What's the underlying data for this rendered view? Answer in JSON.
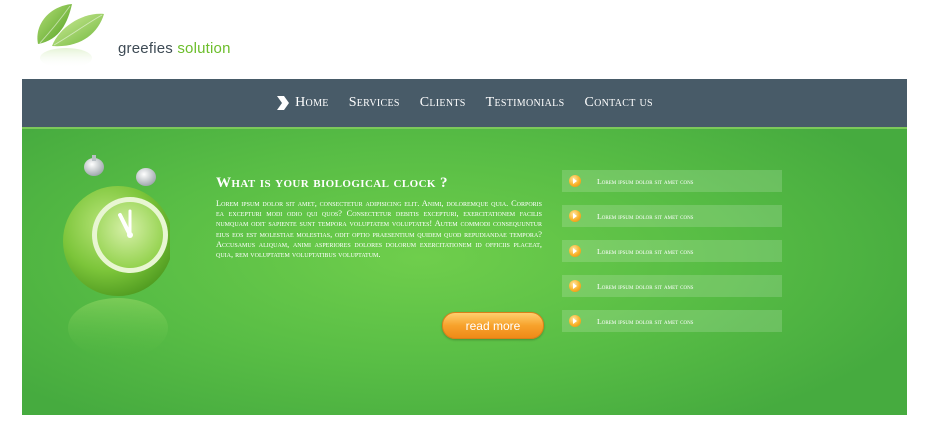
{
  "brand": {
    "name_part1": "greefies",
    "name_part2": " solution"
  },
  "nav": {
    "items": [
      {
        "label": "Home"
      },
      {
        "label": "Services"
      },
      {
        "label": "Clients"
      },
      {
        "label": "Testimonials"
      },
      {
        "label": "Contact us"
      }
    ],
    "active_index": 0
  },
  "hero": {
    "title": "What is your biological clock ?",
    "body": "Lorem ipsum dolor sit amet, consectetur adipisicing elit. Animi, doloremque quia. Corporis ea excepturi modi odio qui quos? Consectetur debitis excepturi, exercitationem facilis numquam odit sapiente sunt tempora voluptatem voluptates! Autem commodi consequuntur eius eos est molestiae molestias, odit optio praesentium quidem quod repudiandae tempora? Accusamus aliquam, animi asperiores dolores dolorum exercitationem id officiis placeat, quia, rem voluptatem voluptatibus voluptatum.",
    "read_more_label": "read more",
    "list": [
      {
        "label": "Lorem ipsum dolor sit amet cons"
      },
      {
        "label": "Lorem ipsum dolor sit amet cons"
      },
      {
        "label": "Lorem ipsum dolor sit amet cons"
      },
      {
        "label": "Lorem ipsum dolor sit amet cons"
      },
      {
        "label": "Lorem ipsum dolor sit amet cons"
      }
    ]
  },
  "colors": {
    "nav_bg": "#485b68",
    "hero_green": "#58bd45",
    "brand_green": "#6cbe2b",
    "button_orange": "#f7a22c"
  },
  "icons": {
    "logo": "leaf-logo-icon",
    "nav_active": "chevron-right-icon",
    "hero_image": "alarm-clock-icon",
    "list_bullet": "orange-arrow-bullet-icon"
  }
}
